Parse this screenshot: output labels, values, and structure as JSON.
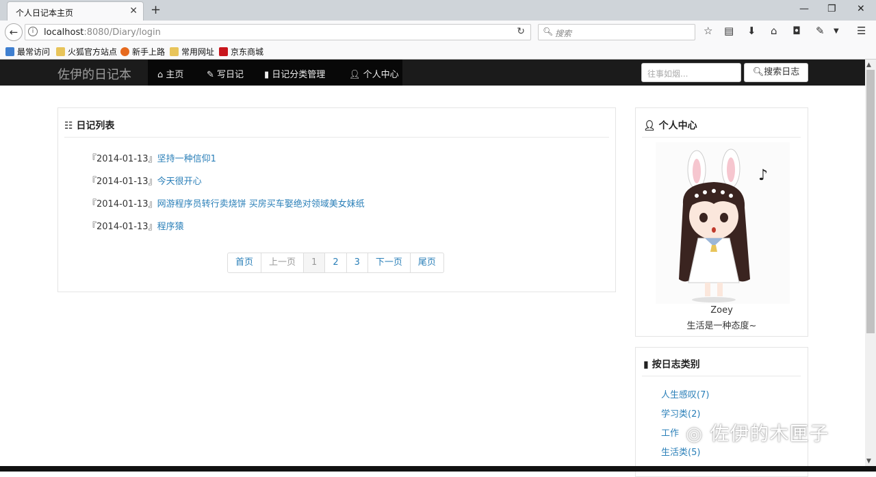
{
  "browser": {
    "tab_title": "个人日记本主页",
    "tab_close": "✕",
    "new_tab": "+",
    "url_host": "localhost",
    "url_rest": ":8080/Diary/login",
    "search_placeholder": "搜索",
    "bookmarks": [
      {
        "label": "最常访问",
        "color": "#3f7fd0"
      },
      {
        "label": "火狐官方站点",
        "color": "#e8c45a"
      },
      {
        "label": "新手上路",
        "color": "#e66a1f"
      },
      {
        "label": "常用网址",
        "color": "#e8c45a"
      },
      {
        "label": "京东商城",
        "color": "#c8161d"
      }
    ]
  },
  "site": {
    "brand": "佐伊的日记本",
    "nav": [
      {
        "label": "主页",
        "icon": "home-icon"
      },
      {
        "label": "写日记",
        "icon": "pencil-icon"
      },
      {
        "label": "日记分类管理",
        "icon": "book-icon"
      },
      {
        "label": "个人中心",
        "icon": "user-icon"
      }
    ],
    "search_placeholder": "往事如烟...",
    "search_button": "搜索日志"
  },
  "diary_list": {
    "title": "日记列表",
    "entries": [
      {
        "date": "『2014-01-13』",
        "title": "坚持一种信仰1"
      },
      {
        "date": "『2014-01-13』",
        "title": "今天很开心"
      },
      {
        "date": "『2014-01-13』",
        "title": "网游程序员转行卖烧饼 买房买车娶绝对领域美女妹纸"
      },
      {
        "date": "『2014-01-13』",
        "title": "程序猿"
      }
    ],
    "pagination": [
      "首页",
      "上一页",
      "1",
      "2",
      "3",
      "下一页",
      "尾页"
    ]
  },
  "profile": {
    "title": "个人中心",
    "name": "Zoey",
    "motto": "生活是一种态度~"
  },
  "categories": {
    "title": "按日志类别",
    "items": [
      "人生感叹(7)",
      "学习类(2)",
      "工作",
      "生活类(5)"
    ]
  },
  "watermark": "佐伊的木匣子",
  "colors": {
    "link": "#2a7fb8",
    "navbar": "#1b1b1b",
    "navbar_active": "#080808"
  }
}
